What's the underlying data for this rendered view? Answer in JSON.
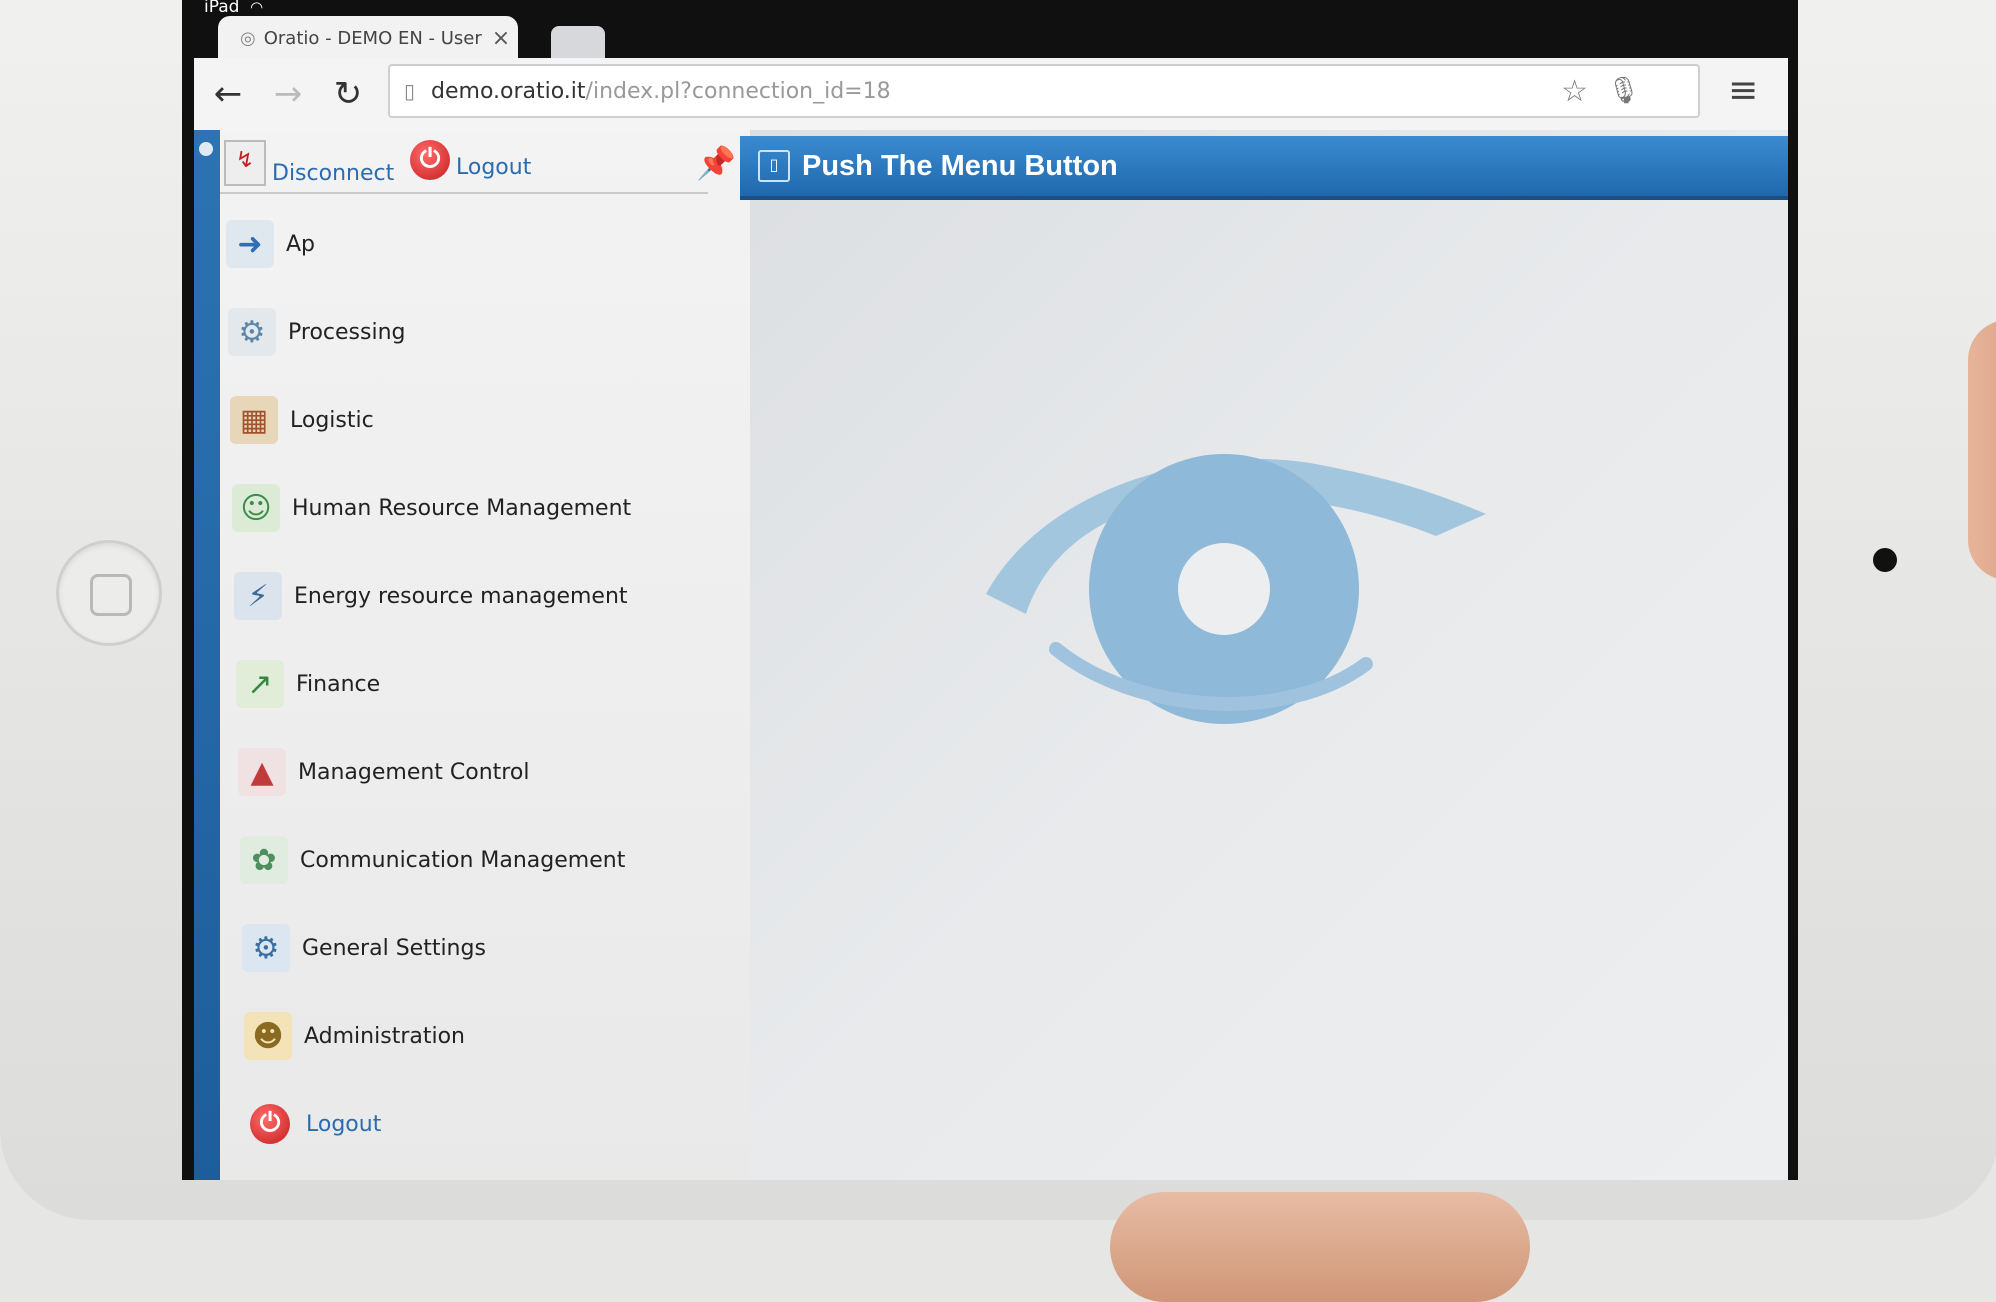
{
  "device": {
    "carrier": "iPad"
  },
  "browser": {
    "tab_title": "Oratio - DEMO EN - User",
    "url_host": "demo.oratio.it",
    "url_path": "/index.pl?connection_id=18"
  },
  "sidebar": {
    "top_links": {
      "disconnect": "Disconnect",
      "logout": "Logout"
    },
    "items": [
      {
        "label": "Ap",
        "icon": "user-arrow-icon"
      },
      {
        "label": "Processing",
        "icon": "gears-icon"
      },
      {
        "label": "Logistic",
        "icon": "truck-icon"
      },
      {
        "label": "Human Resource Management",
        "icon": "people-icon"
      },
      {
        "label": "Energy resource management",
        "icon": "energy-icon"
      },
      {
        "label": "Finance",
        "icon": "finance-icon"
      },
      {
        "label": "Management Control",
        "icon": "chart-icon"
      },
      {
        "label": "Communication Management",
        "icon": "group-icon"
      },
      {
        "label": "General Settings",
        "icon": "settings-icon"
      },
      {
        "label": "Administration",
        "icon": "admin-icon"
      },
      {
        "label": "Logout",
        "icon": "power-icon"
      }
    ]
  },
  "main": {
    "title": "Push The Menu Button"
  },
  "colors": {
    "header_blue": "#2068ae",
    "rail_blue": "#2c73b4",
    "logo_blue": "#9fc3de",
    "logout_red": "#c51d1d"
  }
}
